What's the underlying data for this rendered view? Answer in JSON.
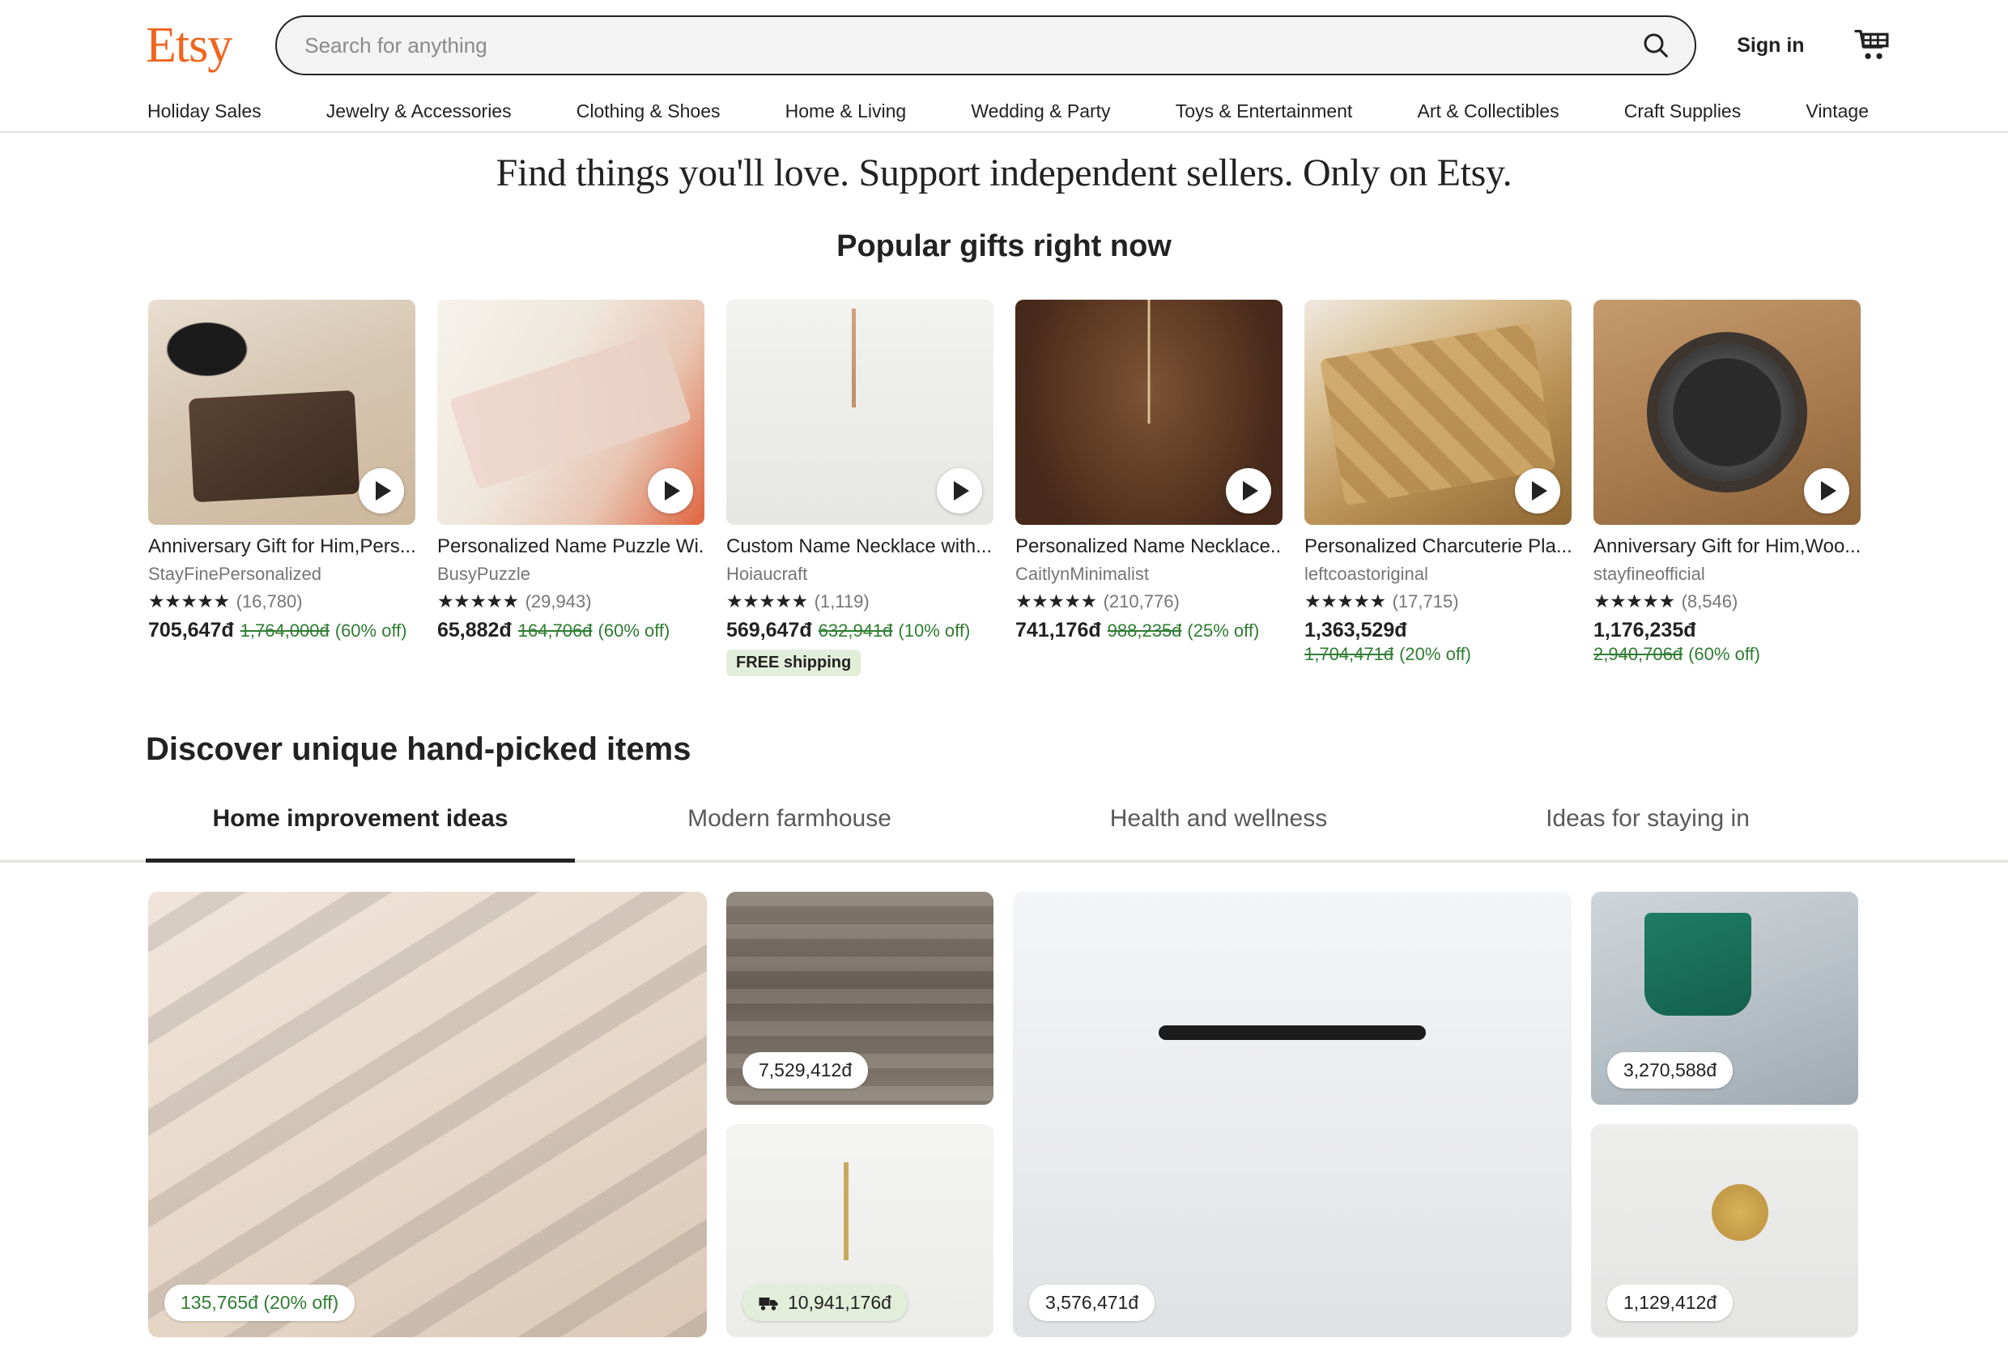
{
  "brand": {
    "name": "Etsy",
    "accent_color": "#f1641e"
  },
  "header": {
    "search_placeholder": "Search for anything",
    "search_value": "",
    "sign_in_label": "Sign in",
    "search_icon": "search-icon",
    "cart_icon": "cart-icon"
  },
  "nav": {
    "items": [
      {
        "label": "Holiday Sales"
      },
      {
        "label": "Jewelry & Accessories"
      },
      {
        "label": "Clothing & Shoes"
      },
      {
        "label": "Home & Living"
      },
      {
        "label": "Wedding & Party"
      },
      {
        "label": "Toys & Entertainment"
      },
      {
        "label": "Art & Collectibles"
      },
      {
        "label": "Craft Supplies"
      },
      {
        "label": "Vintage"
      }
    ]
  },
  "tagline": "Find things you'll love. Support independent sellers. Only on Etsy.",
  "popular": {
    "heading": "Popular gifts right now",
    "items": [
      {
        "title": "Anniversary Gift for Him,Pers...",
        "shop": "StayFinePersonalized",
        "stars": "★★★★★",
        "reviews": "(16,780)",
        "price": "705,647đ",
        "old_price": "1,764,000đ",
        "discount": "(60% off)",
        "free_shipping": "",
        "play_icon": "play-icon",
        "price_two_line": false
      },
      {
        "title": "Personalized Name Puzzle Wi...",
        "shop": "BusyPuzzle",
        "stars": "★★★★★",
        "reviews": "(29,943)",
        "price": "65,882đ",
        "old_price": "164,706đ",
        "discount": "(60% off)",
        "free_shipping": "",
        "play_icon": "play-icon",
        "price_two_line": false
      },
      {
        "title": "Custom Name Necklace with...",
        "shop": "Hoiaucraft",
        "stars": "★★★★★",
        "reviews": "(1,119)",
        "price": "569,647đ",
        "old_price": "632,941đ",
        "discount": "(10% off)",
        "free_shipping": "FREE shipping",
        "play_icon": "play-icon",
        "price_two_line": false
      },
      {
        "title": "Personalized Name Necklace...",
        "shop": "CaitlynMinimalist",
        "stars": "★★★★★",
        "reviews": "(210,776)",
        "price": "741,176đ",
        "old_price": "988,235đ",
        "discount": "(25% off)",
        "free_shipping": "",
        "play_icon": "play-icon",
        "price_two_line": false
      },
      {
        "title": "Personalized Charcuterie Pla...",
        "shop": "leftcoastoriginal",
        "stars": "★★★★★",
        "reviews": "(17,715)",
        "price": "1,363,529đ",
        "old_price": "1,704,471đ",
        "discount": "(20% off)",
        "free_shipping": "",
        "play_icon": "play-icon",
        "price_two_line": true
      },
      {
        "title": "Anniversary Gift for Him,Woo...",
        "shop": "stayfineofficial",
        "stars": "★★★★★",
        "reviews": "(8,546)",
        "price": "1,176,235đ",
        "old_price": "2,940,706đ",
        "discount": "(60% off)",
        "free_shipping": "",
        "play_icon": "play-icon",
        "price_two_line": true
      }
    ]
  },
  "discover": {
    "heading": "Discover unique hand-picked items",
    "tabs": [
      {
        "label": "Home improvement ideas",
        "active": true
      },
      {
        "label": "Modern farmhouse",
        "active": false
      },
      {
        "label": "Health and wellness",
        "active": false
      },
      {
        "label": "Ideas for staying in",
        "active": false
      }
    ],
    "tiles": [
      {
        "id": "leather-handles",
        "price": "135,765đ (20% off)",
        "sale": true,
        "shipping_icon": ""
      },
      {
        "id": "chandelier-wood-wall",
        "price": "7,529,412đ",
        "sale": false,
        "shipping_icon": ""
      },
      {
        "id": "brass-chandelier",
        "price": "10,941,176đ",
        "sale": false,
        "shipping_icon": "truck-icon"
      },
      {
        "id": "black-vanity-light",
        "price": "3,576,471đ",
        "sale": false,
        "shipping_icon": ""
      },
      {
        "id": "grab-bar-install",
        "price": "3,270,588đ",
        "sale": false,
        "shipping_icon": ""
      },
      {
        "id": "brass-sconce",
        "price": "1,129,412đ",
        "sale": false,
        "shipping_icon": ""
      }
    ]
  }
}
